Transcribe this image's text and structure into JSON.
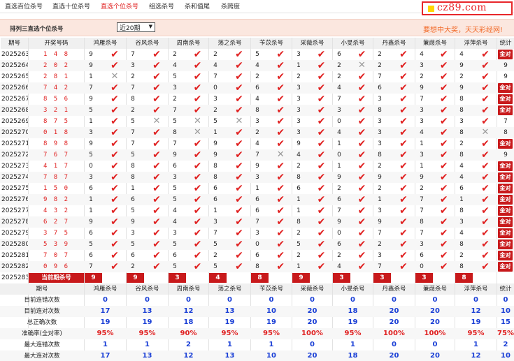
{
  "nav": {
    "tabs": [
      "直选百位杀号",
      "直选十位杀号",
      "直选个位杀号",
      "组选杀号",
      "杀和值尾",
      "杀跨度"
    ],
    "active_index": 2
  },
  "logo": {
    "text": "cz89.com"
  },
  "title_bar": {
    "title": "排列三直选个位杀号",
    "period_select": {
      "selected": "近20期",
      "options": [
        "近20期"
      ]
    },
    "slogan": "要想中大奖，天天彩经网!"
  },
  "table": {
    "headers": [
      "期号",
      "开奖号码",
      "鸿雁杀号",
      "谷风杀号",
      "周南杀号",
      "荡之杀号",
      "苄苡杀号",
      "采薇杀号",
      "小旻杀号",
      "丹鑫杀号",
      "蒹葭杀号",
      "浮萍杀号",
      "统计"
    ],
    "rows": [
      {
        "period": "2025263",
        "draw": "148",
        "picks": [
          [
            9,
            1
          ],
          [
            7,
            1
          ],
          [
            2,
            1
          ],
          [
            2,
            1
          ],
          [
            5,
            1
          ],
          [
            3,
            1
          ],
          [
            6,
            1
          ],
          [
            2,
            1
          ],
          [
            4,
            1
          ],
          [
            4,
            1
          ]
        ],
        "stat": "金对"
      },
      {
        "period": "2025264",
        "draw": "202",
        "picks": [
          [
            9,
            1
          ],
          [
            3,
            1
          ],
          [
            4,
            1
          ],
          [
            4,
            1
          ],
          [
            4,
            1
          ],
          [
            1,
            1
          ],
          [
            2,
            0
          ],
          [
            2,
            1
          ],
          [
            3,
            1
          ],
          [
            9,
            1
          ]
        ],
        "stat": "9"
      },
      {
        "period": "2025265",
        "draw": "281",
        "picks": [
          [
            1,
            0
          ],
          [
            2,
            1
          ],
          [
            5,
            1
          ],
          [
            7,
            1
          ],
          [
            2,
            1
          ],
          [
            2,
            1
          ],
          [
            2,
            1
          ],
          [
            7,
            1
          ],
          [
            2,
            1
          ],
          [
            2,
            1
          ]
        ],
        "stat": "9"
      },
      {
        "period": "2025266",
        "draw": "742",
        "picks": [
          [
            7,
            1
          ],
          [
            7,
            1
          ],
          [
            3,
            1
          ],
          [
            0,
            1
          ],
          [
            6,
            1
          ],
          [
            3,
            1
          ],
          [
            4,
            1
          ],
          [
            6,
            1
          ],
          [
            9,
            1
          ],
          [
            9,
            1
          ]
        ],
        "stat": "金对"
      },
      {
        "period": "2025267",
        "draw": "856",
        "picks": [
          [
            9,
            1
          ],
          [
            8,
            1
          ],
          [
            2,
            1
          ],
          [
            3,
            1
          ],
          [
            4,
            1
          ],
          [
            3,
            1
          ],
          [
            7,
            1
          ],
          [
            3,
            1
          ],
          [
            7,
            1
          ],
          [
            8,
            1
          ]
        ],
        "stat": "金对"
      },
      {
        "period": "2025268",
        "draw": "321",
        "picks": [
          [
            5,
            1
          ],
          [
            2,
            1
          ],
          [
            7,
            1
          ],
          [
            2,
            1
          ],
          [
            8,
            1
          ],
          [
            3,
            1
          ],
          [
            3,
            1
          ],
          [
            8,
            1
          ],
          [
            3,
            1
          ],
          [
            8,
            1
          ]
        ],
        "stat": "金对"
      },
      {
        "period": "2025269",
        "draw": "875",
        "picks": [
          [
            1,
            1
          ],
          [
            5,
            0
          ],
          [
            5,
            0
          ],
          [
            5,
            0
          ],
          [
            3,
            1
          ],
          [
            3,
            1
          ],
          [
            0,
            1
          ],
          [
            3,
            1
          ],
          [
            3,
            1
          ],
          [
            3,
            1
          ]
        ],
        "stat": "7"
      },
      {
        "period": "2025270",
        "draw": "018",
        "picks": [
          [
            3,
            1
          ],
          [
            7,
            1
          ],
          [
            8,
            0
          ],
          [
            1,
            1
          ],
          [
            2,
            1
          ],
          [
            3,
            1
          ],
          [
            4,
            1
          ],
          [
            3,
            1
          ],
          [
            4,
            1
          ],
          [
            8,
            0
          ]
        ],
        "stat": "8"
      },
      {
        "period": "2025271",
        "draw": "898",
        "picks": [
          [
            9,
            1
          ],
          [
            7,
            1
          ],
          [
            7,
            1
          ],
          [
            9,
            1
          ],
          [
            4,
            1
          ],
          [
            9,
            1
          ],
          [
            1,
            1
          ],
          [
            3,
            1
          ],
          [
            1,
            1
          ],
          [
            2,
            1
          ]
        ],
        "stat": "金对"
      },
      {
        "period": "2025272",
        "draw": "767",
        "picks": [
          [
            5,
            1
          ],
          [
            5,
            1
          ],
          [
            9,
            1
          ],
          [
            9,
            1
          ],
          [
            7,
            0
          ],
          [
            4,
            1
          ],
          [
            0,
            1
          ],
          [
            8,
            1
          ],
          [
            3,
            1
          ],
          [
            8,
            1
          ]
        ],
        "stat": "9"
      },
      {
        "period": "2025273",
        "draw": "417",
        "picks": [
          [
            0,
            1
          ],
          [
            8,
            1
          ],
          [
            6,
            1
          ],
          [
            8,
            1
          ],
          [
            9,
            1
          ],
          [
            2,
            1
          ],
          [
            1,
            1
          ],
          [
            2,
            1
          ],
          [
            1,
            1
          ],
          [
            4,
            1
          ]
        ],
        "stat": "金对"
      },
      {
        "period": "2025274",
        "draw": "787",
        "picks": [
          [
            3,
            1
          ],
          [
            8,
            1
          ],
          [
            3,
            1
          ],
          [
            8,
            1
          ],
          [
            3,
            1
          ],
          [
            8,
            1
          ],
          [
            9,
            1
          ],
          [
            9,
            1
          ],
          [
            9,
            1
          ],
          [
            4,
            1
          ]
        ],
        "stat": "金对"
      },
      {
        "period": "2025275",
        "draw": "150",
        "picks": [
          [
            6,
            1
          ],
          [
            1,
            1
          ],
          [
            5,
            1
          ],
          [
            6,
            1
          ],
          [
            1,
            1
          ],
          [
            6,
            1
          ],
          [
            2,
            1
          ],
          [
            2,
            1
          ],
          [
            2,
            1
          ],
          [
            6,
            1
          ]
        ],
        "stat": "金对"
      },
      {
        "period": "2025276",
        "draw": "982",
        "picks": [
          [
            1,
            1
          ],
          [
            6,
            1
          ],
          [
            5,
            1
          ],
          [
            6,
            1
          ],
          [
            6,
            1
          ],
          [
            1,
            1
          ],
          [
            6,
            1
          ],
          [
            1,
            1
          ],
          [
            7,
            1
          ],
          [
            1,
            1
          ]
        ],
        "stat": "金对"
      },
      {
        "period": "2025277",
        "draw": "432",
        "picks": [
          [
            1,
            1
          ],
          [
            5,
            1
          ],
          [
            4,
            1
          ],
          [
            1,
            1
          ],
          [
            6,
            1
          ],
          [
            1,
            1
          ],
          [
            7,
            1
          ],
          [
            3,
            1
          ],
          [
            7,
            1
          ],
          [
            8,
            1
          ]
        ],
        "stat": "金对"
      },
      {
        "period": "2025278",
        "draw": "627",
        "picks": [
          [
            9,
            1
          ],
          [
            9,
            1
          ],
          [
            4,
            1
          ],
          [
            3,
            1
          ],
          [
            7,
            1
          ],
          [
            8,
            1
          ],
          [
            9,
            1
          ],
          [
            9,
            1
          ],
          [
            8,
            1
          ],
          [
            3,
            1
          ]
        ],
        "stat": "金对"
      },
      {
        "period": "2025279",
        "draw": "375",
        "picks": [
          [
            6,
            1
          ],
          [
            3,
            1
          ],
          [
            3,
            1
          ],
          [
            7,
            1
          ],
          [
            3,
            1
          ],
          [
            2,
            1
          ],
          [
            0,
            1
          ],
          [
            7,
            1
          ],
          [
            7,
            1
          ],
          [
            4,
            1
          ]
        ],
        "stat": "金对"
      },
      {
        "period": "2025280",
        "draw": "539",
        "picks": [
          [
            5,
            1
          ],
          [
            5,
            1
          ],
          [
            5,
            1
          ],
          [
            5,
            1
          ],
          [
            0,
            1
          ],
          [
            5,
            1
          ],
          [
            6,
            1
          ],
          [
            2,
            1
          ],
          [
            3,
            1
          ],
          [
            8,
            1
          ]
        ],
        "stat": "金对"
      },
      {
        "period": "2025281",
        "draw": "707",
        "picks": [
          [
            6,
            1
          ],
          [
            6,
            1
          ],
          [
            6,
            1
          ],
          [
            2,
            1
          ],
          [
            6,
            1
          ],
          [
            2,
            1
          ],
          [
            2,
            1
          ],
          [
            3,
            1
          ],
          [
            6,
            1
          ],
          [
            2,
            1
          ]
        ],
        "stat": "金对"
      },
      {
        "period": "2025282",
        "draw": "096",
        "picks": [
          [
            7,
            1
          ],
          [
            2,
            1
          ],
          [
            5,
            1
          ],
          [
            5,
            1
          ],
          [
            8,
            1
          ],
          [
            1,
            1
          ],
          [
            4,
            1
          ],
          [
            7,
            1
          ],
          [
            0,
            1
          ],
          [
            8,
            1
          ]
        ],
        "stat": "金对"
      }
    ],
    "current": {
      "period": "2025283",
      "label": "当前期杀号",
      "picks": [
        "9",
        "9",
        "3",
        "4",
        "8",
        "9",
        "3",
        "3",
        "3",
        "8"
      ]
    }
  },
  "stats": {
    "headers": [
      "期号",
      "",
      "鸿雁杀号",
      "谷风杀号",
      "周南杀号",
      "荡之杀号",
      "苄苡杀号",
      "采薇杀号",
      "小旻杀号",
      "丹鑫杀号",
      "蒹葭杀号",
      "浮萍杀号",
      "统计"
    ],
    "rows": [
      {
        "label": "目前连错次数",
        "values": [
          "0",
          "0",
          "0",
          "0",
          "0",
          "0",
          "0",
          "0",
          "0",
          "0",
          "0"
        ],
        "color": "blue"
      },
      {
        "label": "目前连对次数",
        "values": [
          "17",
          "13",
          "12",
          "13",
          "10",
          "20",
          "18",
          "20",
          "20",
          "12",
          "10"
        ],
        "color": "blue"
      },
      {
        "label": "总正确次数",
        "values": [
          "19",
          "19",
          "18",
          "19",
          "19",
          "20",
          "19",
          "20",
          "20",
          "19",
          "15"
        ],
        "color": "blue"
      },
      {
        "label": "准确率(全对率)",
        "values": [
          "95%",
          "95%",
          "90%",
          "95%",
          "95%",
          "100%",
          "95%",
          "100%",
          "100%",
          "95%",
          "75%"
        ],
        "color": "red"
      },
      {
        "label": "最大连错次数",
        "values": [
          "1",
          "1",
          "2",
          "1",
          "1",
          "0",
          "1",
          "0",
          "0",
          "1",
          "2"
        ],
        "color": "blue"
      },
      {
        "label": "最大连对次数",
        "values": [
          "17",
          "13",
          "12",
          "13",
          "10",
          "20",
          "18",
          "20",
          "20",
          "12",
          "10"
        ],
        "color": "blue"
      }
    ]
  },
  "icons": {
    "hit": "check-mark-icon",
    "miss": "cross-mark-icon"
  },
  "colors": {
    "accent_red": "#e02020",
    "badge_red": "#c8191b",
    "stat_blue": "#1a3fd6",
    "title_bg": "#fbe7df",
    "slogan": "#f26b2a",
    "logo_yellow": "#ffd600"
  }
}
